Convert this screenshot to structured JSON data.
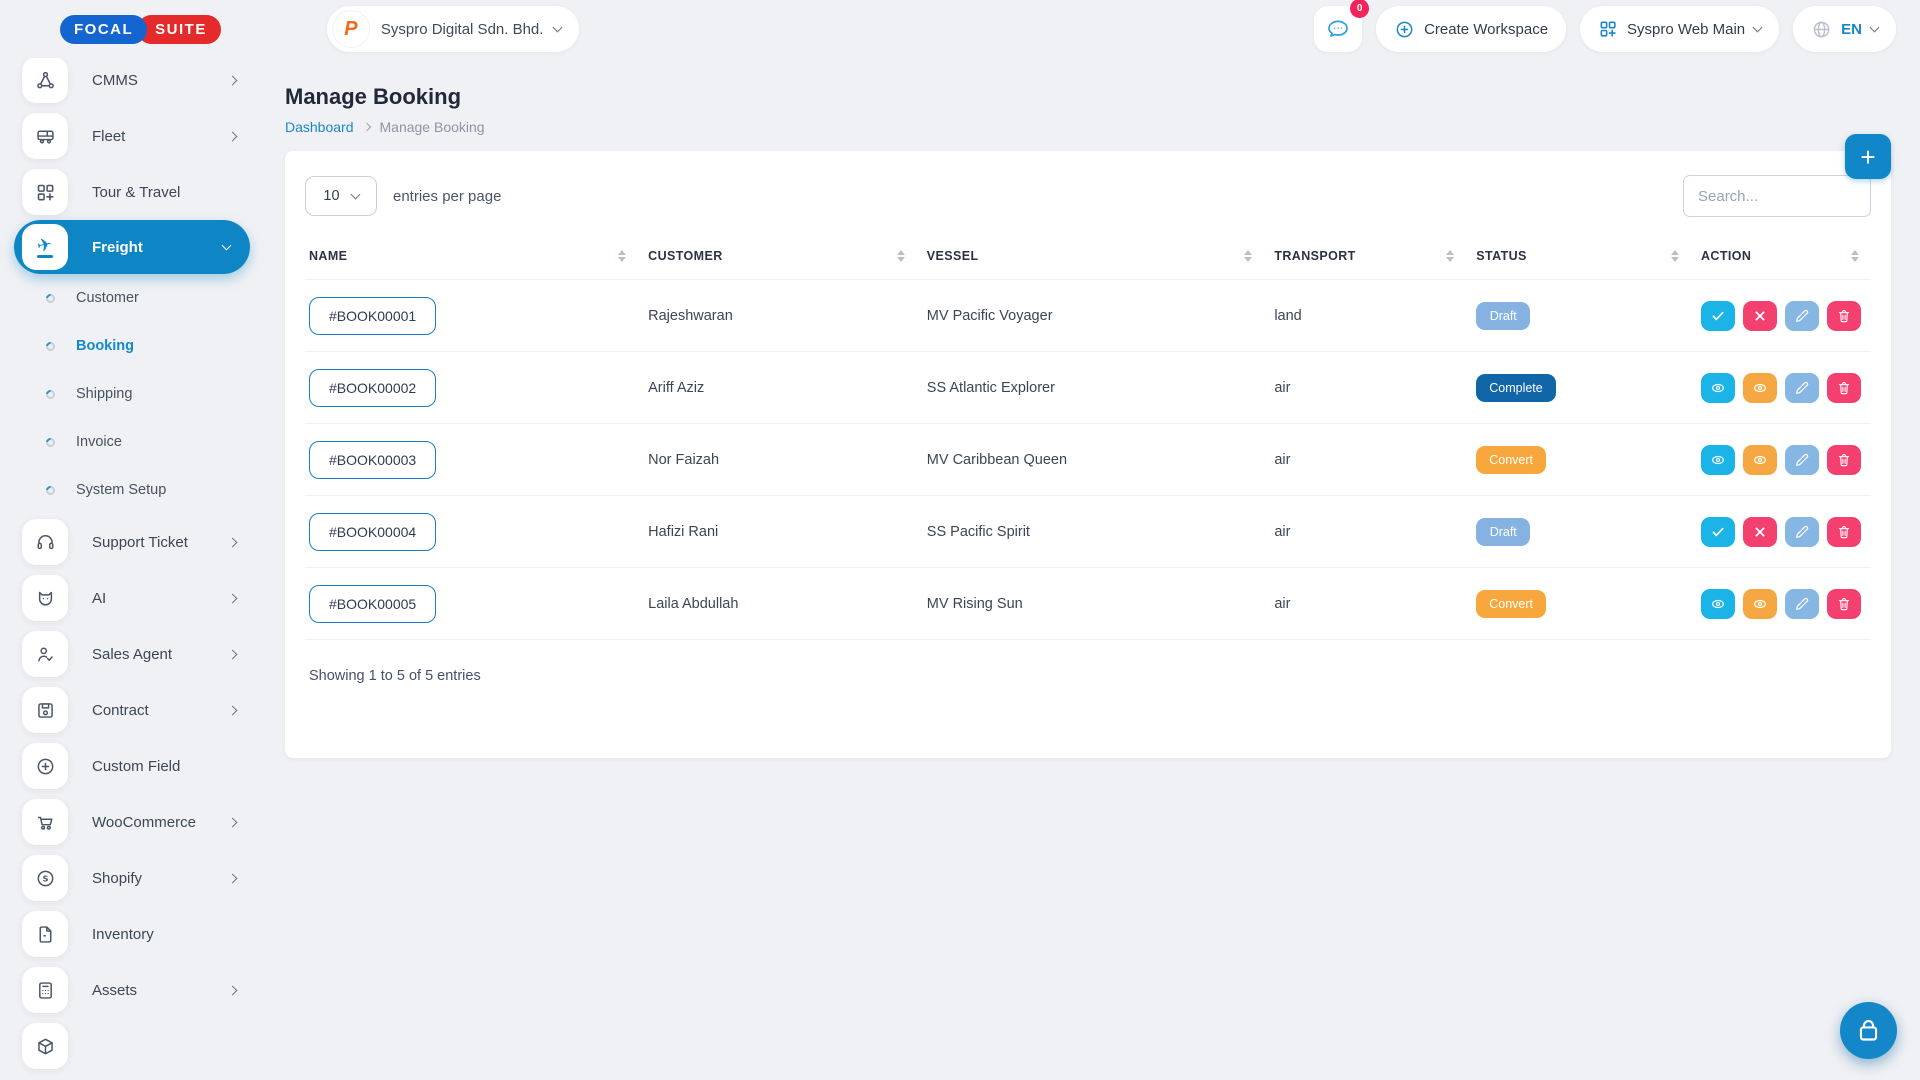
{
  "brand": {
    "logo_primary": "FOCAL",
    "logo_secondary": "SUITE"
  },
  "header": {
    "company_name": "Syspro Digital Sdn. Bhd.",
    "messages_badge": "0",
    "create_workspace_label": "Create Workspace",
    "workspace_name": "Syspro Web Main",
    "language_code": "EN"
  },
  "sidebar": {
    "items": [
      {
        "label": "CMMS",
        "icon": "share-nodes-icon"
      },
      {
        "label": "Fleet",
        "icon": "bus-icon"
      },
      {
        "label": "Tour & Travel",
        "icon": "grid-plus-icon"
      },
      {
        "label": "Freight",
        "icon": "plane-departure-icon",
        "active": true
      },
      {
        "label": "Support Ticket",
        "icon": "headset-icon"
      },
      {
        "label": "AI",
        "icon": "bot-icon"
      },
      {
        "label": "Sales Agent",
        "icon": "person-check-icon"
      },
      {
        "label": "Contract",
        "icon": "save-icon"
      },
      {
        "label": "Custom Field",
        "icon": "circle-plus-icon"
      },
      {
        "label": "WooCommerce",
        "icon": "cart-icon"
      },
      {
        "label": "Shopify",
        "icon": "shopify-icon"
      },
      {
        "label": "Inventory",
        "icon": "file-icon"
      },
      {
        "label": "Assets",
        "icon": "calculator-icon"
      }
    ],
    "sub_items": [
      {
        "label": "Customer"
      },
      {
        "label": "Booking",
        "active": true
      },
      {
        "label": "Shipping"
      },
      {
        "label": "Invoice"
      },
      {
        "label": "System Setup"
      }
    ]
  },
  "page": {
    "title": "Manage Booking",
    "breadcrumb_home": "Dashboard",
    "breadcrumb_current": "Manage Booking"
  },
  "toolbar": {
    "entries_value": "10",
    "entries_label": "entries per page",
    "search_placeholder": "Search..."
  },
  "table": {
    "columns": [
      "NAME",
      "CUSTOMER",
      "VESSEL",
      "TRANSPORT",
      "STATUS",
      "ACTION"
    ],
    "rows": [
      {
        "name": "#BOOK00001",
        "customer": "Rajeshwaran",
        "vessel": "MV Pacific Voyager",
        "transport": "land",
        "status": "Draft",
        "status_color": "#85b2e0",
        "actions": [
          "approve",
          "reject",
          "edit",
          "delete"
        ]
      },
      {
        "name": "#BOOK00002",
        "customer": "Ariff Aziz",
        "vessel": "SS Atlantic Explorer",
        "transport": "air",
        "status": "Complete",
        "status_color": "#1166a8",
        "actions": [
          "view",
          "view-alt",
          "edit",
          "delete"
        ]
      },
      {
        "name": "#BOOK00003",
        "customer": "Nor Faizah",
        "vessel": "MV Caribbean Queen",
        "transport": "air",
        "status": "Convert",
        "status_color": "#f7a73c",
        "actions": [
          "view",
          "view-alt",
          "edit",
          "delete"
        ]
      },
      {
        "name": "#BOOK00004",
        "customer": "Hafizi Rani",
        "vessel": "SS Pacific Spirit",
        "transport": "air",
        "status": "Draft",
        "status_color": "#85b2e0",
        "actions": [
          "approve",
          "reject",
          "edit",
          "delete"
        ]
      },
      {
        "name": "#BOOK00005",
        "customer": "Laila Abdullah",
        "vessel": "MV Rising Sun",
        "transport": "air",
        "status": "Convert",
        "status_color": "#f7a73c",
        "actions": [
          "view",
          "view-alt",
          "edit",
          "delete"
        ]
      }
    ],
    "footer": "Showing 1 to 5 of 5 entries"
  },
  "colors": {
    "primary": "#0e86c5",
    "link": "#1b87c9",
    "action_cyan": "#1ab5e6",
    "action_pink": "#f4406e",
    "action_light_blue": "#86b7e3",
    "action_orange": "#f5a742",
    "badge_draft": "#85b2e0",
    "badge_complete": "#1166a8",
    "badge_convert": "#f7a73c",
    "logo_blue": "#1565d1",
    "logo_red": "#e42a2a"
  }
}
